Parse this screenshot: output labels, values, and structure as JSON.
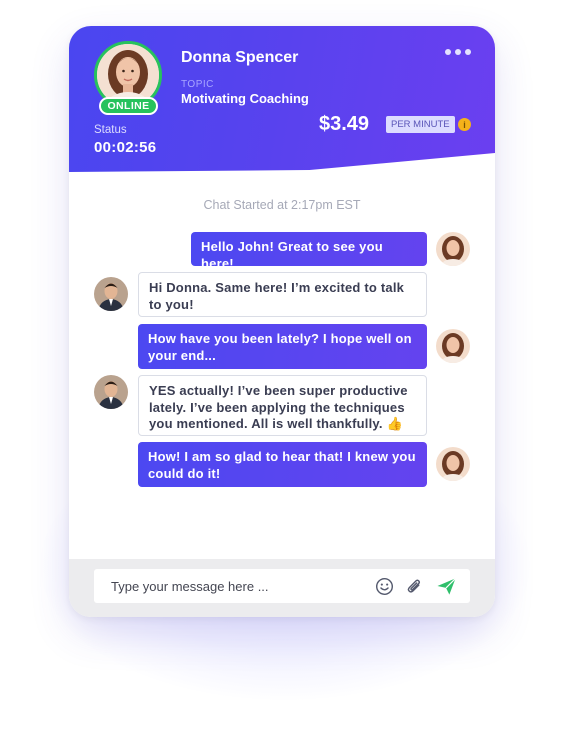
{
  "header": {
    "name": "Donna Spencer",
    "online_badge": "ONLINE",
    "status_label": "Status",
    "status_time": "00:02:56",
    "topic_label": "TOPIC",
    "topic": "Motivating Coaching",
    "price": "$3.49",
    "rate_unit": "PER MINUTE",
    "info_symbol": "i",
    "more_icon": "more-horizontal-icon"
  },
  "chat": {
    "started": "Chat Started at 2:17pm EST",
    "messages": [
      {
        "sender": "Donna",
        "side": "outgoing",
        "text": "Hello John! Great to see you here!"
      },
      {
        "sender": "John",
        "side": "incoming",
        "text": "Hi Donna. Same here! I’m excited to talk to you!"
      },
      {
        "sender": "Donna",
        "side": "outgoing",
        "text": "How have you been lately? I hope well on your end..."
      },
      {
        "sender": "John",
        "side": "incoming",
        "text": "YES actually! I’ve been super productive lately. I’ve been applying the techniques you mentioned. All is well thankfully. 👍"
      },
      {
        "sender": "Donna",
        "side": "outgoing",
        "text": "How! I am so glad to hear that! I knew you could do it!"
      }
    ]
  },
  "composer": {
    "placeholder": "Type your message here ...",
    "emoji_icon": "smile-icon",
    "attach_icon": "paperclip-icon",
    "send_icon": "send-icon"
  },
  "colors": {
    "header_start": "#4a46f0",
    "header_end": "#6b3ff0",
    "online_green": "#27c25d",
    "send_green": "#2fbf6b",
    "info_yellow": "#f5b21a"
  }
}
